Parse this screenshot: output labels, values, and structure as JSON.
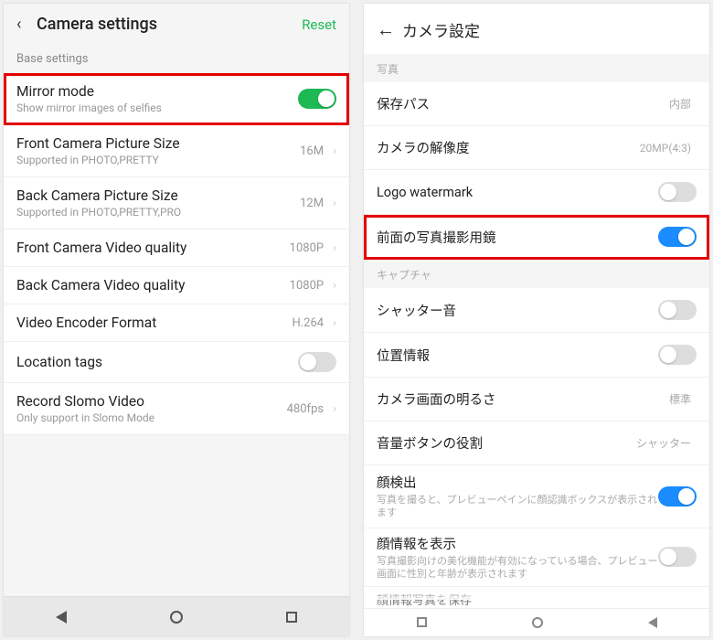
{
  "left": {
    "header": {
      "title": "Camera settings",
      "reset": "Reset"
    },
    "section": "Base settings",
    "rows": {
      "mirror": {
        "label": "Mirror mode",
        "sub": "Show mirror images of selfies"
      },
      "frontSize": {
        "label": "Front Camera Picture Size",
        "sub": "Supported in PHOTO,PRETTY",
        "value": "16M"
      },
      "backSize": {
        "label": "Back Camera Picture Size",
        "sub": "Supported in PHOTO,PRETTY,PRO",
        "value": "12M"
      },
      "frontVideo": {
        "label": "Front Camera Video quality",
        "value": "1080P"
      },
      "backVideo": {
        "label": "Back Camera Video quality",
        "value": "1080P"
      },
      "encoder": {
        "label": "Video Encoder Format",
        "value": "H.264"
      },
      "location": {
        "label": "Location tags"
      },
      "slomo": {
        "label": "Record Slomo Video",
        "sub": "Only support in Slomo Mode",
        "value": "480fps"
      }
    }
  },
  "right": {
    "header": {
      "title": "カメラ設定"
    },
    "section1": "写真",
    "section2": "キャプチャ",
    "rows": {
      "savePath": {
        "label": "保存パス",
        "value": "内部"
      },
      "resolution": {
        "label": "カメラの解像度",
        "value": "20MP(4:3)"
      },
      "logo": {
        "label": "Logo watermark"
      },
      "mirror": {
        "label": "前面の写真撮影用鏡"
      },
      "shutter": {
        "label": "シャッター音"
      },
      "gps": {
        "label": "位置情報"
      },
      "brightness": {
        "label": "カメラ画面の明るさ",
        "value": "標準"
      },
      "volBtn": {
        "label": "音量ボタンの役割",
        "value": "シャッター"
      },
      "faceDetect": {
        "label": "顔検出",
        "sub": "写真を撮ると、プレビューペインに顔認識ボックスが表示されます"
      },
      "faceInfo": {
        "label": "顔情報を表示",
        "sub": "写真撮影向けの美化機能が有効になっている場合、プレビュー画面に性別と年齢が表示されます"
      },
      "faceSave": {
        "label": "顔情報写真を保存"
      }
    }
  }
}
